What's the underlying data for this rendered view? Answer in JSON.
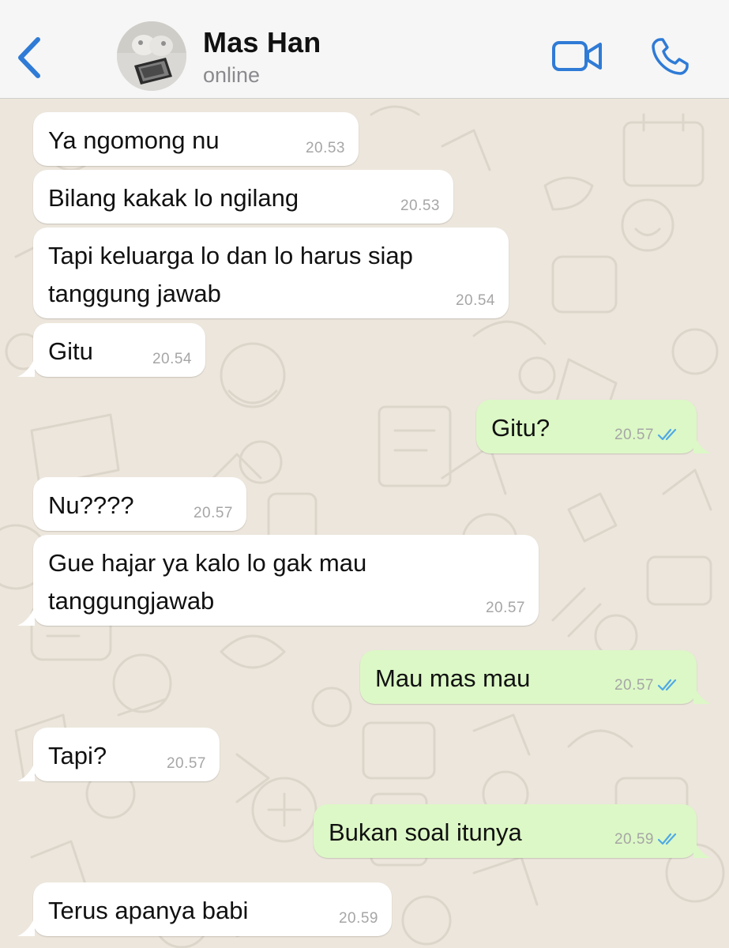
{
  "header": {
    "back_icon": "chevron-left-icon",
    "contact_name": "Mas Han",
    "status": "online",
    "video_icon": "video-camera-icon",
    "call_icon": "phone-icon",
    "accent_color": "#2f7bd6"
  },
  "messages": [
    {
      "dir": "in",
      "lines": [
        "Ya ngomong nu"
      ],
      "time": "20.53"
    },
    {
      "dir": "in",
      "lines": [
        "Bilang kakak lo ngilang"
      ],
      "time": "20.53"
    },
    {
      "dir": "in",
      "lines": [
        "Tapi keluarga lo dan lo harus siap",
        "tanggung jawab"
      ],
      "time": "20.54"
    },
    {
      "dir": "in",
      "lines": [
        "Gitu"
      ],
      "time": "20.54"
    },
    {
      "dir": "out",
      "lines": [
        "Gitu?"
      ],
      "time": "20.57",
      "status": "read"
    },
    {
      "dir": "in",
      "lines": [
        "Nu????"
      ],
      "time": "20.57"
    },
    {
      "dir": "in",
      "lines": [
        "Gue hajar ya kalo lo gak mau",
        "tanggungjawab"
      ],
      "time": "20.57"
    },
    {
      "dir": "out",
      "lines": [
        "Mau mas mau"
      ],
      "time": "20.57",
      "status": "read"
    },
    {
      "dir": "in",
      "lines": [
        "Tapi?"
      ],
      "time": "20.57"
    },
    {
      "dir": "out",
      "lines": [
        "Bukan soal itunya"
      ],
      "time": "20.59",
      "status": "read"
    },
    {
      "dir": "in",
      "lines": [
        "Terus apanya babi"
      ],
      "time": "20.59"
    }
  ],
  "colors": {
    "incoming_bubble": "#ffffff",
    "outgoing_bubble": "#dcf8c6",
    "read_ticks": "#4fa9e6",
    "chat_background": "#ece6dc"
  }
}
